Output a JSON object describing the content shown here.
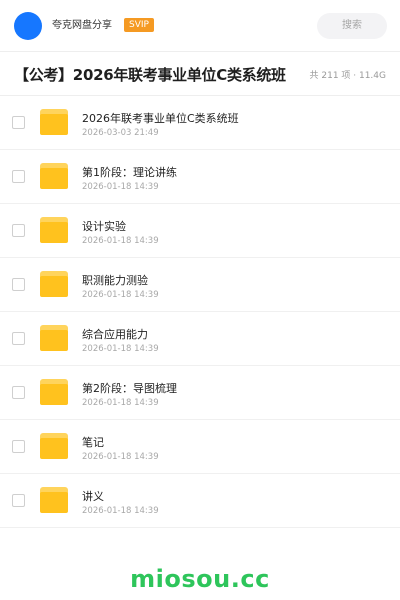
{
  "header": {
    "sharer_name": "夸克网盘分享",
    "badge": "SVIP",
    "search_placeholder": "搜索"
  },
  "folder": {
    "title": "【公考】2026年联考事业单位C类系统班",
    "meta": "共 211 项 · 11.4G"
  },
  "files": [
    {
      "name": "2026年联考事业单位C类系统班",
      "date": "2026-03-03 21:49"
    },
    {
      "name": "第1阶段：理论讲练",
      "date": "2026-01-18 14:39"
    },
    {
      "name": "设计实验",
      "date": "2026-01-18 14:39"
    },
    {
      "name": "职测能力测验",
      "date": "2026-01-18 14:39"
    },
    {
      "name": "综合应用能力",
      "date": "2026-01-18 14:39"
    },
    {
      "name": "第2阶段：导图梳理",
      "date": "2026-01-18 14:39"
    },
    {
      "name": "笔记",
      "date": "2026-01-18 14:39"
    },
    {
      "name": "讲义",
      "date": "2026-01-18 14:39"
    }
  ],
  "watermark": "miosou.cc",
  "colors": {
    "avatar": "#1677ff",
    "badge": "#f59a23",
    "folder_icon": "#ffc21e",
    "watermark": "#2ec55b"
  }
}
